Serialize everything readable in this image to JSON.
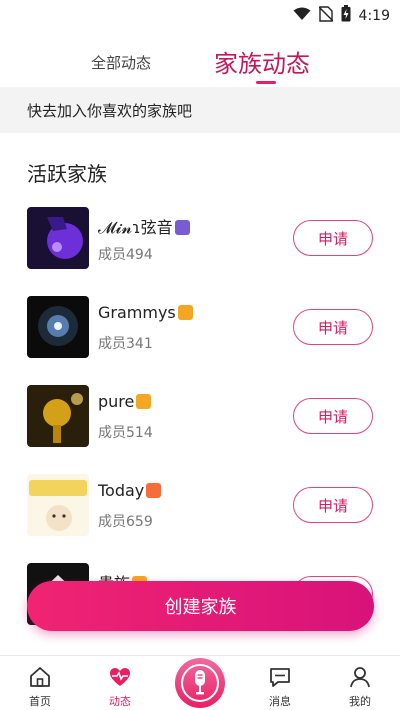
{
  "status_bar": {
    "time": "4:19",
    "icons": [
      "wifi-icon",
      "no-sim-icon",
      "battery-icon"
    ]
  },
  "tabs": [
    {
      "label": "全部动态",
      "active": false
    },
    {
      "label": "家族动态",
      "active": true
    }
  ],
  "banner": {
    "text": "快去加入你喜欢的家族吧"
  },
  "section": {
    "title": "活跃家族"
  },
  "families": [
    {
      "name": "𝓜𝓲𝓷ɿ弦音",
      "members": "成员494",
      "apply_label": "申请",
      "badge_color": "#7a5bd6"
    },
    {
      "name": "Grammys",
      "members": "成员341",
      "apply_label": "申请",
      "badge_color": "#f5a623"
    },
    {
      "name": "pure",
      "members": "成员514",
      "apply_label": "申请",
      "badge_color": "#f5a623"
    },
    {
      "name": "Today",
      "members": "成员659",
      "apply_label": "申请",
      "badge_color": "#f76d3a"
    },
    {
      "name": "贵族",
      "members": "",
      "apply_label": "申请",
      "badge_color": "#f5a623"
    }
  ],
  "create_button": {
    "label": "创建家族"
  },
  "bottom_nav": [
    {
      "label": "首页",
      "icon": "home-icon",
      "active": false
    },
    {
      "label": "动态",
      "icon": "heartbeat-icon",
      "active": true
    },
    {
      "label": "",
      "icon": "microphone-icon",
      "active": false
    },
    {
      "label": "消息",
      "icon": "message-icon",
      "active": false
    },
    {
      "label": "我的",
      "icon": "profile-icon",
      "active": false
    }
  ],
  "colors": {
    "accent": "#e91e63",
    "accent_dark": "#c2185b",
    "banner_bg": "#f3f3f3"
  }
}
